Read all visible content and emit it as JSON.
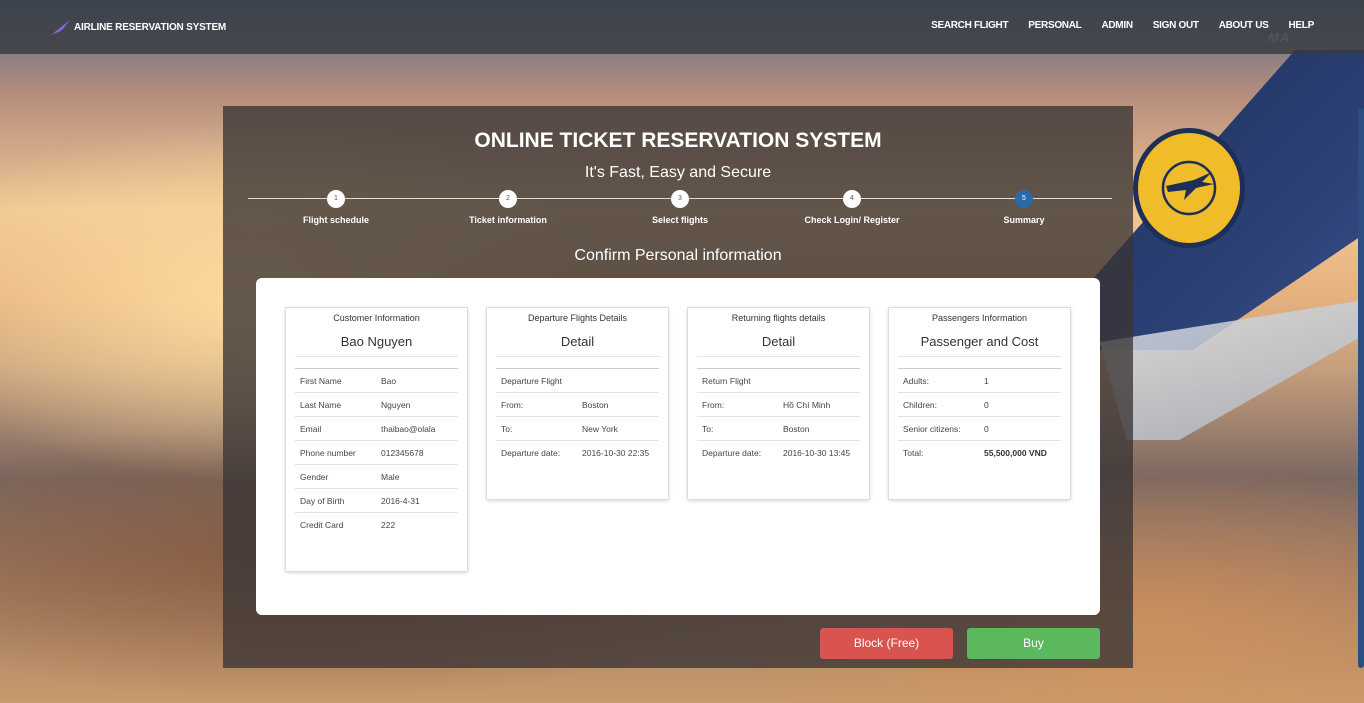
{
  "brand": {
    "name": "AIRLINE RESERVATION SYSTEM"
  },
  "nav": [
    "SEARCH FLIGHT",
    "PERSONAL",
    "ADMIN",
    "SIGN OUT",
    "ABOUT US",
    "HELP"
  ],
  "watermark": "MA",
  "header": {
    "title": "ONLINE TICKET RESERVATION SYSTEM",
    "subtitle": "It's Fast, Easy and Secure"
  },
  "steps": [
    {
      "num": "1",
      "label": "Flight schedule"
    },
    {
      "num": "2",
      "label": "Ticket information"
    },
    {
      "num": "3",
      "label": "Select flights"
    },
    {
      "num": "4",
      "label": "Check Login/ Register"
    },
    {
      "num": "5",
      "label": "Summary",
      "active": true
    }
  ],
  "section_title": "Confirm Personal information",
  "cards": {
    "customer": {
      "header": "Customer Information",
      "title": "Bao Nguyen",
      "rows": [
        [
          "First Name",
          "Bao"
        ],
        [
          "Last Name",
          "Nguyen"
        ],
        [
          "Email",
          "thaibao@olala"
        ],
        [
          "Phone number",
          "012345678"
        ],
        [
          "Gender",
          "Male"
        ],
        [
          "Day of Birth",
          "2016-4-31"
        ],
        [
          "Credit Card",
          "222"
        ]
      ]
    },
    "departure": {
      "header": "Departure Flights Details",
      "title": "Detail",
      "rows": [
        [
          "Departure Flight",
          ""
        ],
        [
          "From:",
          "Boston"
        ],
        [
          "To:",
          "New York"
        ],
        [
          "Departure date:",
          "2016-10-30 22:35"
        ]
      ]
    },
    "returning": {
      "header": "Returning flights details",
      "title": "Detail",
      "rows": [
        [
          "Return Flight",
          ""
        ],
        [
          "From:",
          "Hồ Chí Minh"
        ],
        [
          "To:",
          "Boston"
        ],
        [
          "Departure date:",
          "2016-10-30 13:45"
        ]
      ]
    },
    "passengers": {
      "header": "Passengers Information",
      "title": "Passenger and Cost",
      "rows": [
        [
          "Adults:",
          "1"
        ],
        [
          "Children:",
          "0"
        ],
        [
          "Senior citizens:",
          "0"
        ],
        [
          "Total:",
          "55,500,000 VND"
        ]
      ]
    }
  },
  "buttons": {
    "block": "Block (Free)",
    "buy": "Buy"
  },
  "colors": {
    "navbar": "#373a40",
    "active_step": "#2b6aa8",
    "block_button": "#d9534f",
    "buy_button": "#5cb85c"
  }
}
